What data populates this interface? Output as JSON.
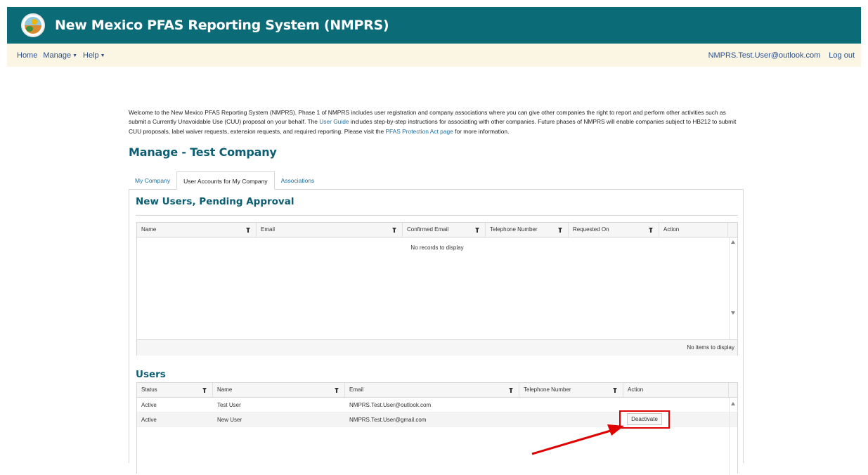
{
  "header": {
    "app_title": "New Mexico PFAS Reporting System (NMPRS)",
    "logo_icon": "state-seal-icon",
    "banner_color": "#0b6b77"
  },
  "nav": {
    "home": "Home",
    "manage": "Manage",
    "help": "Help",
    "user_email": "NMPRS.Test.User@outlook.com",
    "logout": "Log out"
  },
  "welcome": {
    "text_1": "Welcome to the New Mexico PFAS Reporting System (NMPRS). Phase 1 of NMPRS includes user registration and company associations where you can give other companies the right to report and perform other activities such as submit a Currently Unavoidable Use (CUU) proposal on your behalf. The ",
    "link_user_guide": "User Guide",
    "text_2": " includes step-by-step instructions for associating with other companies. Future phases of NMPRS will enable companies subject to HB212 to submit CUU proposals, label waiver requests, extension requests, and required reporting. Please visit the ",
    "link_pfas": "PFAS Protection Act page",
    "text_3": " for more information."
  },
  "page_title": "Manage - Test Company",
  "tabs": {
    "my_company": "My Company",
    "user_accounts": "User Accounts for My Company",
    "associations": "Associations"
  },
  "pending": {
    "title": "New Users, Pending Approval",
    "columns": {
      "name": "Name",
      "email": "Email",
      "confirmed_email": "Confirmed Email",
      "telephone": "Telephone Number",
      "requested_on": "Requested On",
      "action": "Action"
    },
    "empty_message": "No records to display",
    "footer": "No items to display"
  },
  "users": {
    "title": "Users",
    "columns": {
      "status": "Status",
      "name": "Name",
      "email": "Email",
      "telephone": "Telephone Number",
      "action": "Action"
    },
    "rows": [
      {
        "status": "Active",
        "name": "Test User",
        "email": "NMPRS.Test.User@outlook.com",
        "telephone": "",
        "action": ""
      },
      {
        "status": "Active",
        "name": "New User",
        "email": "NMPRS.Test.User@gmail.com",
        "telephone": "",
        "action": "Deactivate"
      }
    ]
  },
  "annotation_color": "#e00000"
}
